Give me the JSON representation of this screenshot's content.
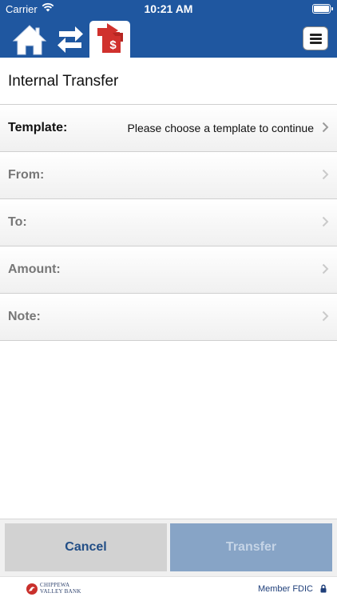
{
  "status_bar": {
    "carrier": "Carrier",
    "time": "10:21 AM"
  },
  "nav": {
    "items": [
      {
        "name": "home",
        "icon": "home-icon"
      },
      {
        "name": "transfers",
        "icon": "transfer-arrows-icon"
      },
      {
        "name": "internal-transfer",
        "icon": "transfer-dollar-icon",
        "active": true
      }
    ],
    "menu_icon": "hamburger-menu-icon"
  },
  "page": {
    "title": "Internal Transfer"
  },
  "form": {
    "template": {
      "label": "Template:",
      "value": "Please choose a template to continue"
    },
    "from": {
      "label": "From:"
    },
    "to": {
      "label": "To:"
    },
    "amount": {
      "label": "Amount:"
    },
    "note": {
      "label": "Note:"
    }
  },
  "actions": {
    "cancel_label": "Cancel",
    "transfer_label": "Transfer"
  },
  "footer": {
    "logo_line1": "CHIPPEWA",
    "logo_line2": "VALLEY BANK",
    "fdic_text": "Member FDIC"
  },
  "colors": {
    "brand_blue": "#1f57a0",
    "accent_red": "#d0312d",
    "disabled_button": "#87a4c6"
  }
}
